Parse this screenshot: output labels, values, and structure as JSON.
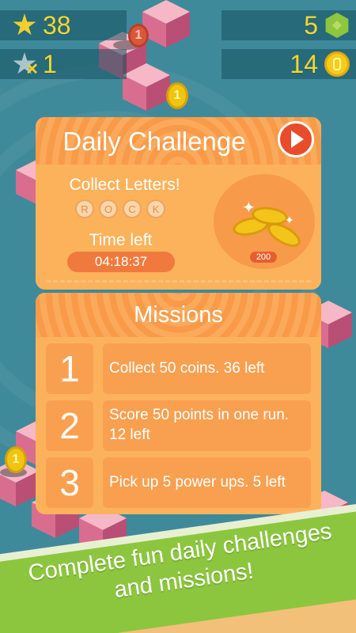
{
  "hud": {
    "stars": "38",
    "star_tokens": "1",
    "gems": "5",
    "coins": "14"
  },
  "daily": {
    "title": "Daily Challenge",
    "collect_label": "Collect Letters!",
    "letters": [
      "R",
      "O",
      "C",
      "K"
    ],
    "time_label": "Time left",
    "time_value": "04:18:37",
    "reward_amount": "200"
  },
  "missions": {
    "title": "Missions",
    "items": [
      {
        "num": "1",
        "text": "Collect 50 coins. 36 left"
      },
      {
        "num": "2",
        "text": "Score 50 points in one run. 12 left"
      },
      {
        "num": "3",
        "text": "Pick up 5 power ups. 5 left"
      }
    ]
  },
  "banner": {
    "text": "Complete fun daily challenges and missions!"
  },
  "icons": [
    "star-icon",
    "star-token-icon",
    "gem-icon",
    "coin-icon",
    "play-icon"
  ],
  "colors": {
    "panel": "#fcb25b",
    "accent": "#f07a3d",
    "play": "#e84c2b",
    "banner": "#8cc63f",
    "hud_text": "#f4d62f"
  }
}
